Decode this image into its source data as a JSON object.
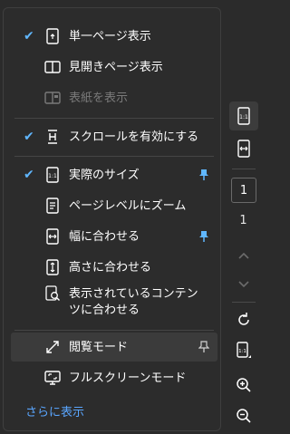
{
  "menu": {
    "items": [
      {
        "label": "単一ページ表示",
        "checked": true,
        "icon": "single-page-icon",
        "pinned": false,
        "disabled": false
      },
      {
        "label": "見開きページ表示",
        "checked": false,
        "icon": "two-page-icon",
        "pinned": false,
        "disabled": false
      },
      {
        "label": "表紙を表示",
        "checked": false,
        "icon": "cover-page-icon",
        "pinned": false,
        "disabled": true
      },
      {
        "label": "スクロールを有効にする",
        "checked": true,
        "icon": "scroll-icon",
        "pinned": false,
        "disabled": false
      },
      {
        "label": "実際のサイズ",
        "checked": true,
        "icon": "actual-size-icon",
        "pinned": true,
        "disabled": false
      },
      {
        "label": "ページレベルにズーム",
        "checked": false,
        "icon": "fit-page-icon",
        "pinned": false,
        "disabled": false
      },
      {
        "label": "幅に合わせる",
        "checked": false,
        "icon": "fit-width-icon",
        "pinned": true,
        "disabled": false
      },
      {
        "label": "高さに合わせる",
        "checked": false,
        "icon": "fit-height-icon",
        "pinned": false,
        "disabled": false
      },
      {
        "label_line1": "表示されているコンテン",
        "label_line2": "ツに合わせる",
        "checked": false,
        "icon": "fit-visible-icon",
        "pinned": false,
        "disabled": false
      },
      {
        "label": "閲覧モード",
        "checked": false,
        "icon": "reading-mode-icon",
        "pinned": "outline",
        "disabled": false
      },
      {
        "label": "フルスクリーンモード",
        "checked": false,
        "icon": "fullscreen-icon",
        "pinned": false,
        "disabled": false
      }
    ],
    "more_label": "さらに表示"
  },
  "rail": {
    "current_page": "1",
    "total_pages": "1"
  },
  "colors": {
    "accent": "#60b7ff",
    "link": "#5aa6ff",
    "background": "#2b2b2b"
  }
}
